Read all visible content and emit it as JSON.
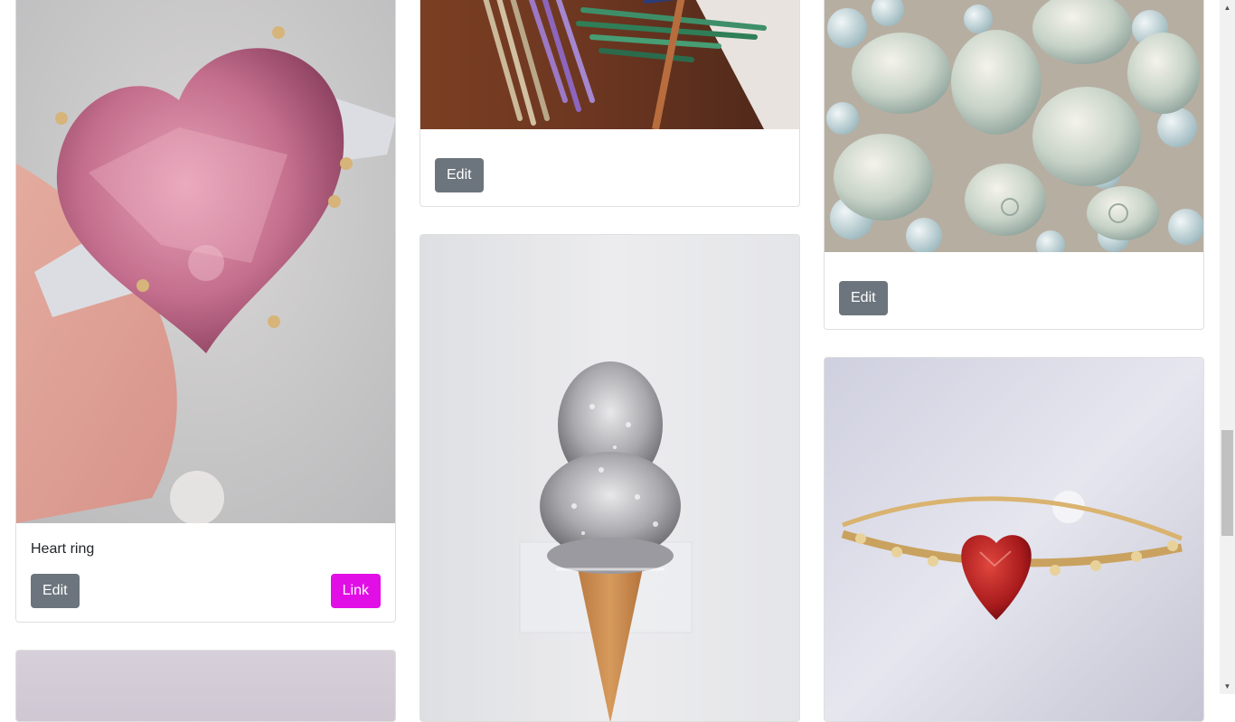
{
  "cards": [
    {
      "id": "heart-ring",
      "title": "Heart ring",
      "edit_label": "Edit",
      "link_label": "Link"
    },
    {
      "id": "glitter-brushes",
      "edit_label": "Edit"
    },
    {
      "id": "sea-shells",
      "edit_label": "Edit"
    },
    {
      "id": "glitter-ice-cream"
    },
    {
      "id": "red-heart-ring"
    },
    {
      "id": "partial-bottom"
    }
  ],
  "colors": {
    "edit_button": "#6c757d",
    "link_button": "#e20ee6"
  }
}
